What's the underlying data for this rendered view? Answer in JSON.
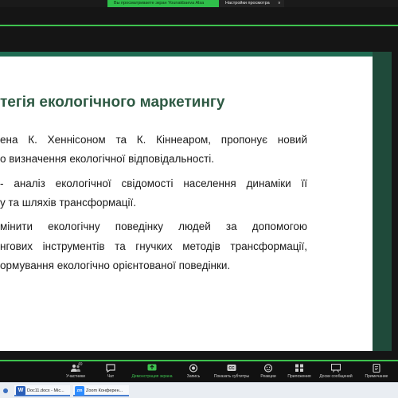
{
  "share_banner": {
    "status_text": "Вы просматриваете экран Younakbaeva Alsa",
    "settings_label": "Настройки просмотра",
    "settings_chevron": "v"
  },
  "slide": {
    "title": "тегія екологічного маркетингу",
    "paragraph1": [
      "ена К. Хеннісоном та К. Кіннеаром, пропонує новий",
      "о визначення екологічної відповідальності."
    ],
    "paragraph2": [
      "- аналіз екологічної свідомості населення динаміки її",
      "у та шляхів трансформації."
    ],
    "paragraph3": [
      "мінити екологічну поведінку людей за допомогою",
      "нгових інструментів та гнучких методів трансформації,",
      "ормування екологічно орієнтованої поведінки."
    ],
    "colors": {
      "title": "#2f5a44",
      "band": "#1f6b52",
      "sidebar": "#1f4a3a"
    }
  },
  "toolbar": {
    "participants_count": "49",
    "items": [
      {
        "label": "Участники",
        "icon": "participants-icon"
      },
      {
        "label": "Чат",
        "icon": "chat-icon"
      },
      {
        "label": "Демонстрация экрана",
        "icon": "share-screen-icon",
        "active": true
      },
      {
        "label": "Запись",
        "icon": "record-icon"
      },
      {
        "label": "Показать субтитры",
        "icon": "cc-icon"
      },
      {
        "label": "Реакции",
        "icon": "reactions-icon"
      },
      {
        "label": "Приложения",
        "icon": "apps-icon"
      },
      {
        "label": "Доски сообщений",
        "icon": "whiteboard-icon"
      },
      {
        "label": "Примечание",
        "icon": "notes-icon"
      }
    ],
    "accent": "#3ec24f"
  },
  "taskbar": {
    "items": [
      {
        "label": "Doc11.docx - Mic...",
        "icon": "word-icon",
        "glyph": "W"
      },
      {
        "label": "Zoom Конферен...",
        "icon": "zoom-icon",
        "glyph": "zm"
      }
    ]
  }
}
